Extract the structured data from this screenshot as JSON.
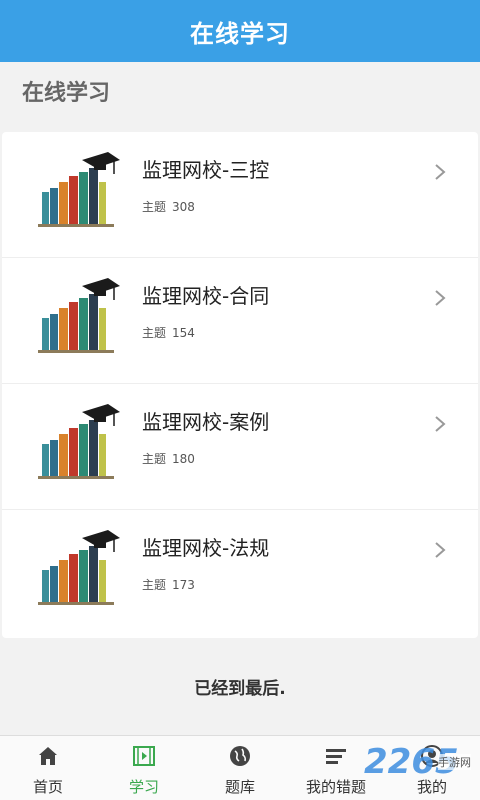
{
  "header": {
    "title": "在线学习"
  },
  "section": {
    "title": "在线学习"
  },
  "courses": [
    {
      "name": "监理网校-三控",
      "meta_label": "主题",
      "count": "308"
    },
    {
      "name": "监理网校-合同",
      "meta_label": "主题",
      "count": "154"
    },
    {
      "name": "监理网校-案例",
      "meta_label": "主题",
      "count": "180"
    },
    {
      "name": "监理网校-法规",
      "meta_label": "主题",
      "count": "173"
    }
  ],
  "footer_note": "已经到最后.",
  "tabs": [
    {
      "label": "首页",
      "icon": "home-icon"
    },
    {
      "label": "学习",
      "icon": "video-icon",
      "active": true
    },
    {
      "label": "题库",
      "icon": "globe-icon"
    },
    {
      "label": "我的错题",
      "icon": "list-icon"
    },
    {
      "label": "我的",
      "icon": "user-icon"
    }
  ],
  "watermark": {
    "brand": "2265",
    "sub": "手游网"
  },
  "colors": {
    "primary": "#3aa0e6",
    "active_tab": "#3aa84e"
  }
}
